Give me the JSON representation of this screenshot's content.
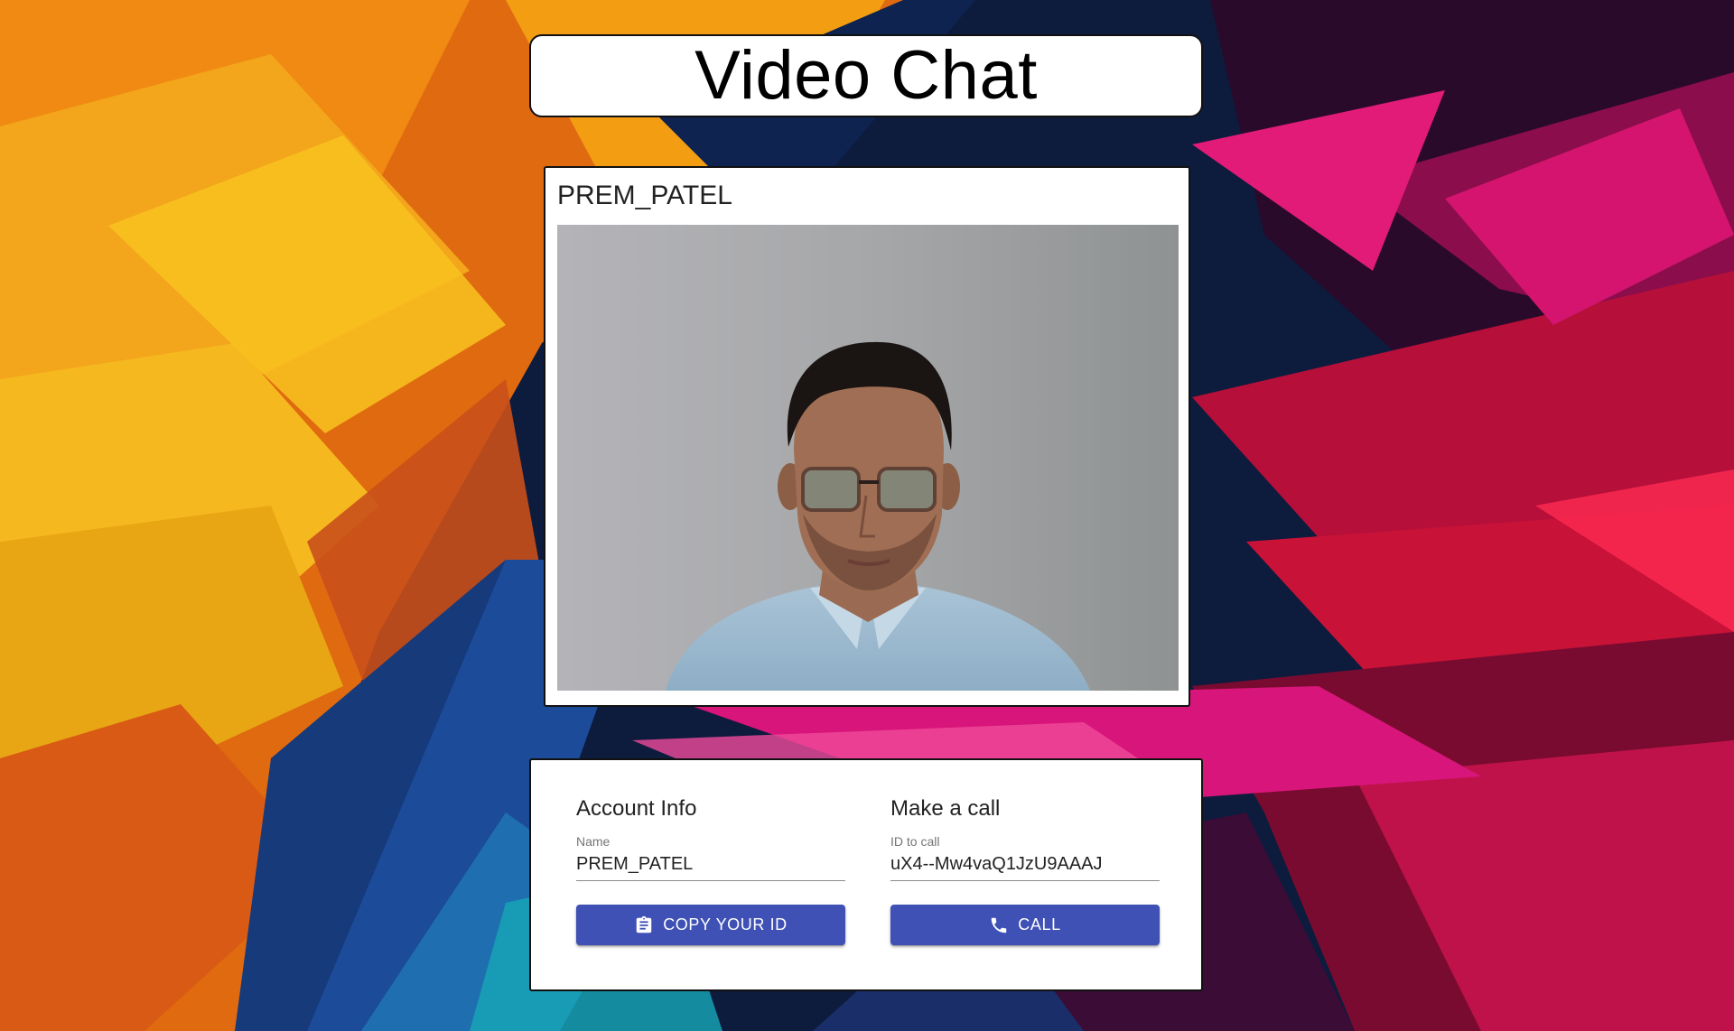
{
  "app": {
    "title": "Video Chat"
  },
  "video": {
    "name": "PREM_PATEL"
  },
  "account": {
    "heading": "Account Info",
    "name_label": "Name",
    "name_value": "PREM_PATEL",
    "copy_button_label": "COPY YOUR ID",
    "copy_icon": "clipboard-icon"
  },
  "call": {
    "heading": "Make a call",
    "id_label": "ID to call",
    "id_value": "uX4--Mw4vaQ1JzU9AAAJ",
    "call_button_label": "CALL",
    "call_icon": "phone-icon"
  },
  "colors": {
    "primary": "#3f51b5",
    "card": "#ffffff"
  }
}
